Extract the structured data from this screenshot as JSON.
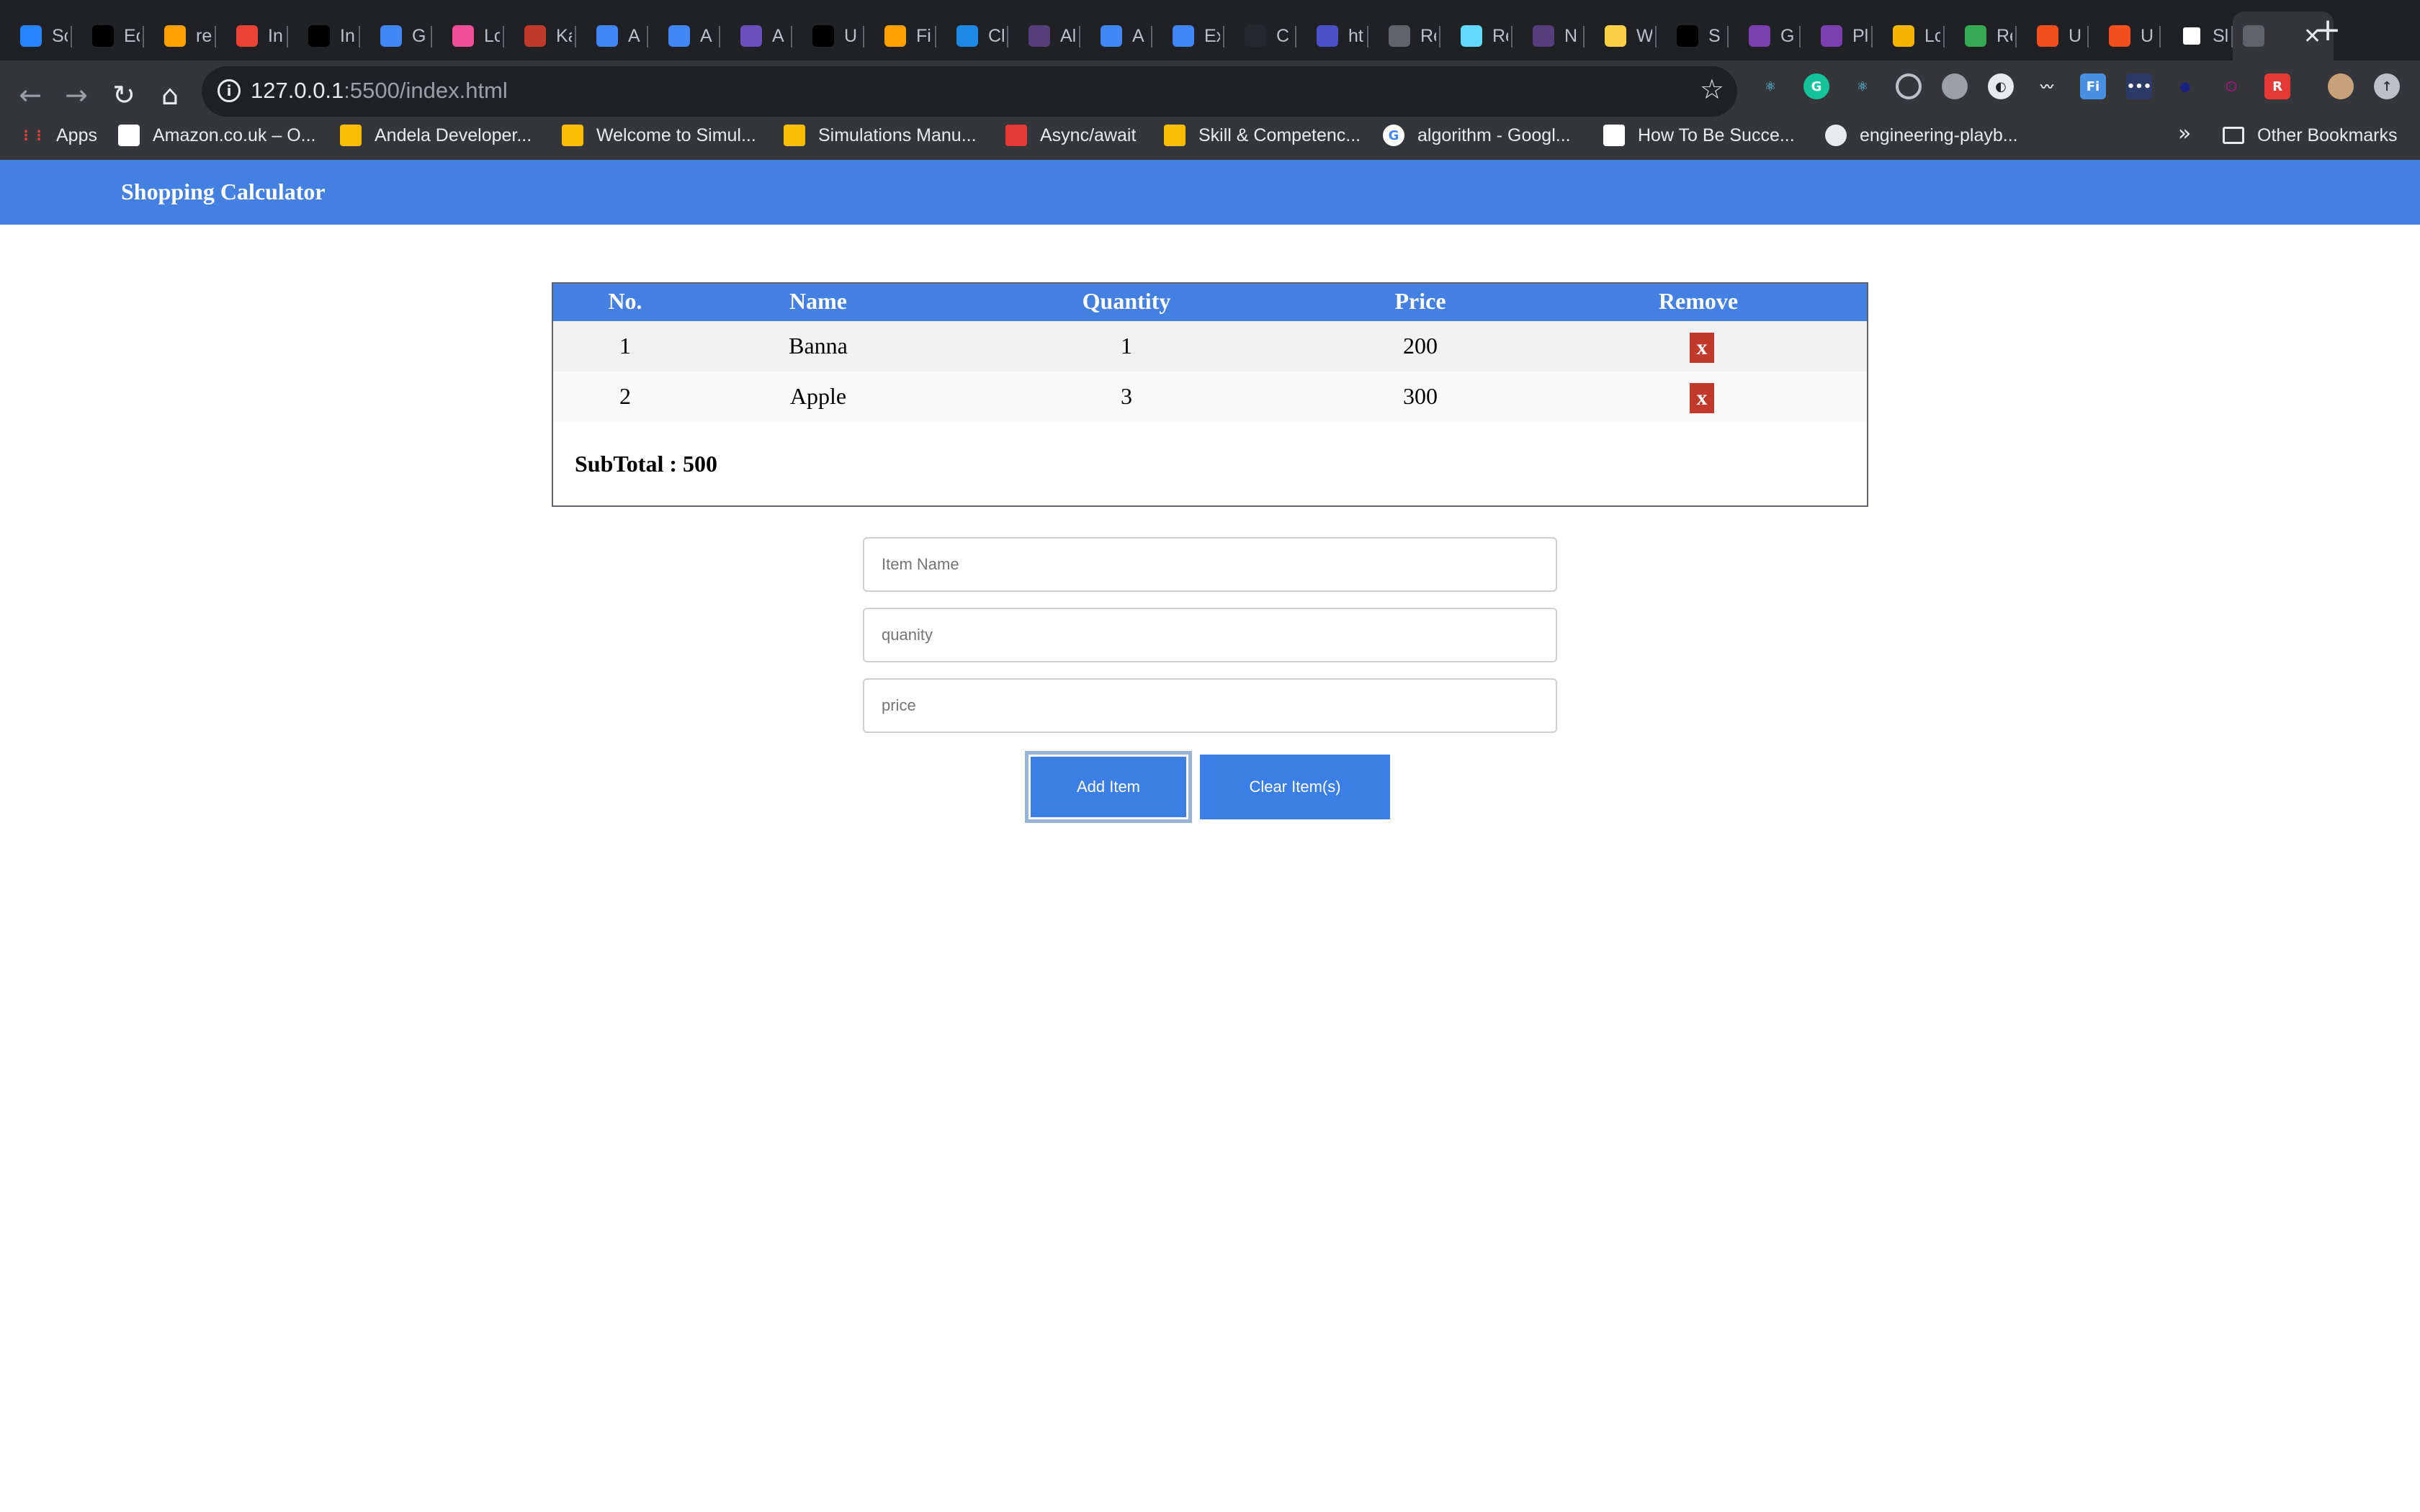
{
  "browser": {
    "tabs": [
      {
        "label": "Sc",
        "icon": "atlassian-icon",
        "color": "#2684ff"
      },
      {
        "label": "Ec",
        "icon": "dev-icon",
        "color": "#000000"
      },
      {
        "label": "re",
        "icon": "firebase-icon",
        "color": "#ffa000"
      },
      {
        "label": "In",
        "icon": "gmail-icon",
        "color": "#ea4335"
      },
      {
        "label": "In",
        "icon": "medium-icon",
        "color": "#000000"
      },
      {
        "label": "G",
        "icon": "docs-icon",
        "color": "#4285f4"
      },
      {
        "label": "Lc",
        "icon": "kibana-icon",
        "color": "#f04e98"
      },
      {
        "label": "Ka",
        "icon": "openai-icon",
        "color": "#c0392b"
      },
      {
        "label": "A",
        "icon": "gcloud-icon",
        "color": "#4285f4"
      },
      {
        "label": "A",
        "icon": "gcloud-icon",
        "color": "#4285f4"
      },
      {
        "label": "A",
        "icon": "list-icon",
        "color": "#6b4fbb"
      },
      {
        "label": "U",
        "icon": "medium-icon",
        "color": "#000000"
      },
      {
        "label": "Fi",
        "icon": "firebase-icon",
        "color": "#ffa000"
      },
      {
        "label": "Cl",
        "icon": "cloud-icon",
        "color": "#1e88e5"
      },
      {
        "label": "Al",
        "icon": "bootstrap-icon",
        "color": "#563d7c"
      },
      {
        "label": "A",
        "icon": "gcloud-icon",
        "color": "#4285f4"
      },
      {
        "label": "Ex",
        "icon": "gcloud-icon",
        "color": "#4285f4"
      },
      {
        "label": "C",
        "icon": "github-icon",
        "color": "#24292e"
      },
      {
        "label": "ht",
        "icon": "xcd-icon",
        "color": "#4b50c8"
      },
      {
        "label": "Re",
        "icon": "globe-icon",
        "color": "#5f6368"
      },
      {
        "label": "Re",
        "icon": "react-icon",
        "color": "#61dafb"
      },
      {
        "label": "N",
        "icon": "bootstrap-icon",
        "color": "#563d7c"
      },
      {
        "label": "W",
        "icon": "python-icon",
        "color": "#f7d046"
      },
      {
        "label": "S",
        "icon": "dev-icon",
        "color": "#000000"
      },
      {
        "label": "G",
        "icon": "graphql-icon",
        "color": "#7b3fb0"
      },
      {
        "label": "Pl",
        "icon": "graphql-icon",
        "color": "#7b3fb0"
      },
      {
        "label": "Lc",
        "icon": "lightning-icon",
        "color": "#f4b400"
      },
      {
        "label": "Re",
        "icon": "sheet-icon",
        "color": "#34a853"
      },
      {
        "label": "U",
        "icon": "figma-icon",
        "color": "#f24e1e"
      },
      {
        "label": "U",
        "icon": "figma-icon",
        "color": "#f24e1e"
      },
      {
        "label": "Sl",
        "icon": "codesandbox-icon",
        "color": "#ffffff"
      },
      {
        "label": "",
        "icon": "globe-icon",
        "color": "#5f6368",
        "active": true
      }
    ],
    "url": {
      "host": "127.0.0.1",
      "path": ":5500/index.html"
    },
    "bookmarks": [
      {
        "label": "Apps",
        "icon": "apps-grid-icon",
        "color": "#ea4335"
      },
      {
        "label": "Amazon.co.uk – O...",
        "icon": "amazon-icon",
        "color": "#ffffff"
      },
      {
        "label": "Andela Developer...",
        "icon": "drive-icon",
        "color": "#fbbc04"
      },
      {
        "label": "Welcome to Simul...",
        "icon": "drive-icon",
        "color": "#fbbc04"
      },
      {
        "label": "Simulations Manu...",
        "icon": "drive-icon",
        "color": "#fbbc04"
      },
      {
        "label": "Async/await",
        "icon": "figure-icon",
        "color": "#e53935"
      },
      {
        "label": "Skill & Competenc...",
        "icon": "drive-icon",
        "color": "#fbbc04"
      },
      {
        "label": "algorithm - Googl...",
        "icon": "google-icon",
        "color": "#4285f4"
      },
      {
        "label": "How To Be Succe...",
        "icon": "medium-icon",
        "color": "#ffffff"
      },
      {
        "label": "engineering-playb...",
        "icon": "github-icon",
        "color": "#e8eaed"
      }
    ],
    "bookmarks_more": "»",
    "other_bookmarks": "Other Bookmarks"
  },
  "app": {
    "title": "Shopping Calculator",
    "table": {
      "headers": [
        "No.",
        "Name",
        "Quantity",
        "Price",
        "Remove"
      ],
      "rows": [
        {
          "no": "1",
          "name": "Banna",
          "quantity": "1",
          "price": "200",
          "remove": "x"
        },
        {
          "no": "2",
          "name": "Apple",
          "quantity": "3",
          "price": "300",
          "remove": "x"
        }
      ],
      "subtotal": "SubTotal : 500"
    },
    "form": {
      "item_name_placeholder": "Item Name",
      "quantity_placeholder": "quanity",
      "price_placeholder": "price",
      "add_label": "Add Item",
      "clear_label": "Clear Item(s)"
    }
  },
  "colors": {
    "accent": "#4380e2",
    "remove": "#c0392b"
  }
}
